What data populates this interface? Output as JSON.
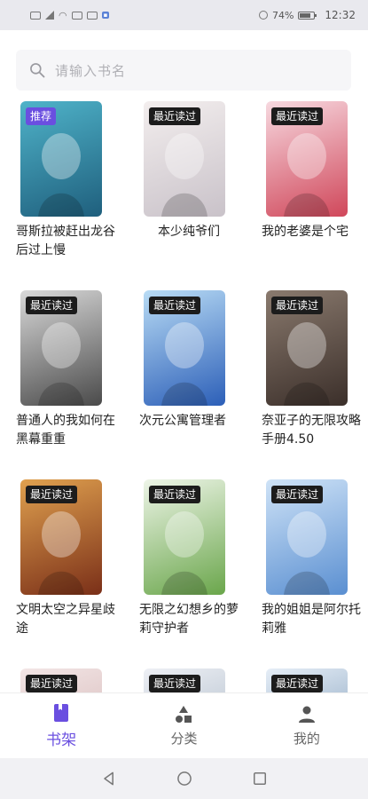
{
  "status_bar": {
    "battery": "74%",
    "time": "12:32"
  },
  "search": {
    "placeholder": "请输入书名"
  },
  "books": [
    {
      "title": "哥斯拉被赶出龙谷后过上慢",
      "tag": "推荐",
      "cover_colors": [
        "#4fb3c9",
        "#1f5f7d"
      ],
      "align": "left"
    },
    {
      "title": "本少纯爷们",
      "tag": "最近读过",
      "cover_colors": [
        "#f3eeee",
        "#c9c2c9"
      ],
      "align": "center"
    },
    {
      "title": "我的老婆是个宅",
      "tag": "最近读过",
      "cover_colors": [
        "#f7d9e0",
        "#d0475a"
      ],
      "align": "left"
    },
    {
      "title": "普通人的我如何在黑幕重重",
      "tag": "最近读过",
      "cover_colors": [
        "#d9d9d9",
        "#4a4a4a"
      ],
      "align": "left"
    },
    {
      "title": "次元公寓管理者",
      "tag": "最近读过",
      "cover_colors": [
        "#b9dcf5",
        "#2c5fb8"
      ],
      "align": "left"
    },
    {
      "title": "奈亚子的无限攻略手册4.50",
      "tag": "最近读过",
      "cover_colors": [
        "#8a7a6e",
        "#3b2f2a"
      ],
      "align": "left"
    },
    {
      "title": "文明太空之异星歧途",
      "tag": "最近读过",
      "cover_colors": [
        "#e0a14f",
        "#7a2f18"
      ],
      "align": "left"
    },
    {
      "title": "无限之幻想乡的萝莉守护者",
      "tag": "最近读过",
      "cover_colors": [
        "#eef5e8",
        "#6aa64b"
      ],
      "align": "left"
    },
    {
      "title": "我的姐姐是阿尔托莉雅",
      "tag": "最近读过",
      "cover_colors": [
        "#cfe3f7",
        "#5a8fd1"
      ],
      "align": "left"
    },
    {
      "title": "",
      "tag": "最近读过",
      "cover_colors": [
        "#f3e6e6",
        "#caa"
      ],
      "align": "left"
    },
    {
      "title": "",
      "tag": "最近读过",
      "cover_colors": [
        "#eef0f5",
        "#9ab"
      ],
      "align": "left"
    },
    {
      "title": "",
      "tag": "最近读过",
      "cover_colors": [
        "#e6eef7",
        "#68a"
      ],
      "align": "left"
    }
  ],
  "nav": {
    "bookshelf": "书架",
    "category": "分类",
    "mine": "我的",
    "active_color": "#6a4fe0"
  }
}
